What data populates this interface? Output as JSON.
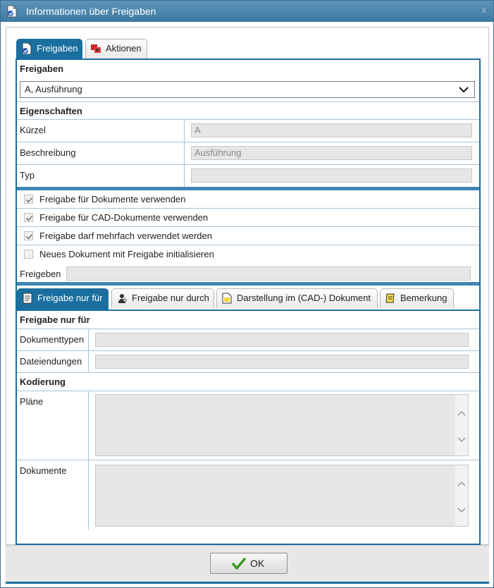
{
  "window": {
    "title": "Informationen über Freigaben",
    "close_glyph": "x"
  },
  "top_tabs": [
    {
      "label": "Freigaben",
      "icon": "document-check-icon",
      "active": true
    },
    {
      "label": "Aktionen",
      "icon": "actions-icon",
      "active": false
    }
  ],
  "freigaben": {
    "header": "Freigaben",
    "selected": "A, Ausführung"
  },
  "eigenschaften": {
    "header": "Eigenschaften",
    "fields": [
      {
        "label": "Kürzel",
        "value": "A"
      },
      {
        "label": "Beschreibung",
        "value": "Ausführung"
      },
      {
        "label": "Typ",
        "value": ""
      }
    ]
  },
  "checkboxes": [
    {
      "label": "Freigabe für Dokumente verwenden",
      "checked": true
    },
    {
      "label": "Freigabe für CAD-Dokumente verwenden",
      "checked": true
    },
    {
      "label": "Freigabe darf mehrfach verwendet werden",
      "checked": true
    },
    {
      "label": "Neues Dokument mit Freigabe initialisieren",
      "checked": false
    }
  ],
  "freigeben": {
    "label": "Freigeben",
    "value": ""
  },
  "sub_tabs": [
    {
      "label": "Freigabe nur für",
      "icon": "document-list-icon",
      "active": true
    },
    {
      "label": "Freigabe nur durch",
      "icon": "user-gear-icon",
      "active": false
    },
    {
      "label": "Darstellung im (CAD-) Dokument",
      "icon": "document-note-icon",
      "active": false
    },
    {
      "label": "Bemerkung",
      "icon": "note-icon",
      "active": false
    }
  ],
  "freigabe_nur_fuer": {
    "header": "Freigabe nur für",
    "fields": [
      {
        "label": "Dokumenttypen",
        "value": ""
      },
      {
        "label": "Dateiendungen",
        "value": ""
      }
    ]
  },
  "kodierung": {
    "header": "Kodierung",
    "areas": [
      {
        "label": "Pläne",
        "value": ""
      },
      {
        "label": "Dokumente",
        "value": ""
      }
    ]
  },
  "footer": {
    "ok_label": "OK"
  },
  "colors": {
    "accent": "#1b6f9f",
    "title_bar": "#4a86ad",
    "check": "#3a9a1e"
  }
}
